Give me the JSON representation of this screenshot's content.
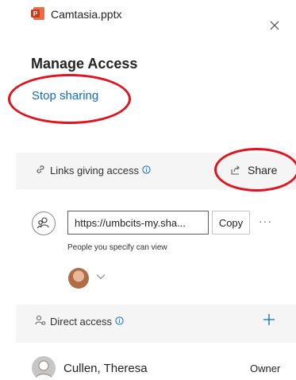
{
  "header": {
    "file_name": "Camtasia.pptx",
    "file_icon": "powerpoint-file-icon",
    "close_icon": "close-icon",
    "title": "Manage Access"
  },
  "stop_sharing_label": "Stop sharing",
  "links_section": {
    "label": "Links giving access",
    "share_label": "Share",
    "link": {
      "url": "https://umbcits-my.sha...",
      "copy_label": "Copy",
      "more_label": "···",
      "scope": "People you specify can view"
    }
  },
  "direct_section": {
    "label": "Direct access",
    "people": [
      {
        "name": "Cullen, Theresa",
        "role": "Owner"
      }
    ]
  },
  "colors": {
    "link_blue": "#0f6cbd",
    "annotation_red": "#e0141e",
    "section_band": "#f5f5f5"
  }
}
